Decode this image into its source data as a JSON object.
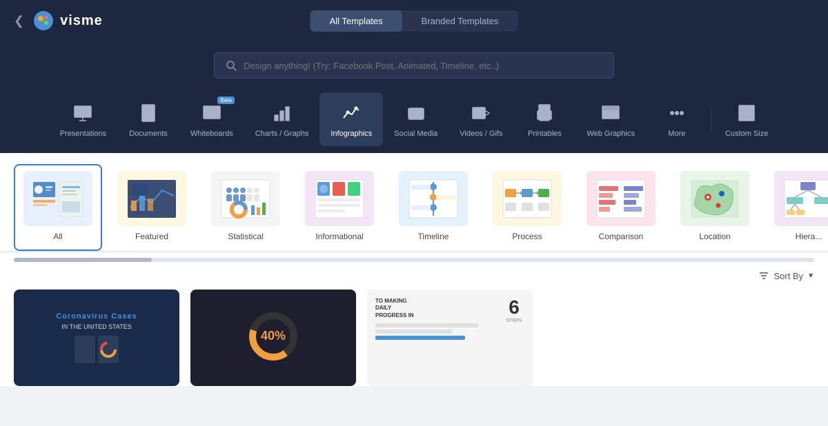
{
  "app": {
    "title": "visme",
    "back_icon": "❮"
  },
  "tabs": {
    "all_label": "All Templates",
    "branded_label": "Branded Templates",
    "active": "all"
  },
  "search": {
    "placeholder": "Design anything! (Try: Facebook Post, Animated, Timeline, etc..)"
  },
  "categories": [
    {
      "id": "presentations",
      "label": "Presentations",
      "active": false
    },
    {
      "id": "documents",
      "label": "Documents",
      "active": false
    },
    {
      "id": "whiteboards",
      "label": "Whiteboards",
      "beta": true,
      "active": false
    },
    {
      "id": "charts-graphs",
      "label": "Charts / Graphs",
      "active": false
    },
    {
      "id": "infographics",
      "label": "Infographics",
      "active": true
    },
    {
      "id": "social-media",
      "label": "Social Media",
      "active": false
    },
    {
      "id": "videos-gifs",
      "label": "Videos / Gifs",
      "active": false
    },
    {
      "id": "printables",
      "label": "Printables",
      "active": false
    },
    {
      "id": "web-graphics",
      "label": "Web Graphics",
      "active": false
    },
    {
      "id": "more",
      "label": "More",
      "active": false
    },
    {
      "id": "custom-size",
      "label": "Custom Size",
      "active": false
    }
  ],
  "subcategories": [
    {
      "id": "all",
      "label": "All",
      "active": true
    },
    {
      "id": "featured",
      "label": "Featured",
      "active": false
    },
    {
      "id": "statistical",
      "label": "Statistical",
      "active": false
    },
    {
      "id": "informational",
      "label": "Informational",
      "active": false
    },
    {
      "id": "timeline",
      "label": "Timeline",
      "active": false
    },
    {
      "id": "process",
      "label": "Process",
      "active": false
    },
    {
      "id": "comparison",
      "label": "Comparison",
      "active": false
    },
    {
      "id": "location",
      "label": "Location",
      "active": false
    },
    {
      "id": "hierarchical",
      "label": "Hiera...",
      "active": false
    }
  ],
  "sort": {
    "label": "Sort By",
    "icon": "▼"
  },
  "template_cards": [
    {
      "id": "corona",
      "title": "Coronavirus Cases in the United States",
      "bg": "#1a2a4a"
    },
    {
      "id": "forty",
      "title": "40%",
      "bg": "#2d2d2d"
    },
    {
      "id": "daily",
      "title": "TO MAKING DAILY PROGRESS IN",
      "bg": "#f5f5f5"
    }
  ]
}
